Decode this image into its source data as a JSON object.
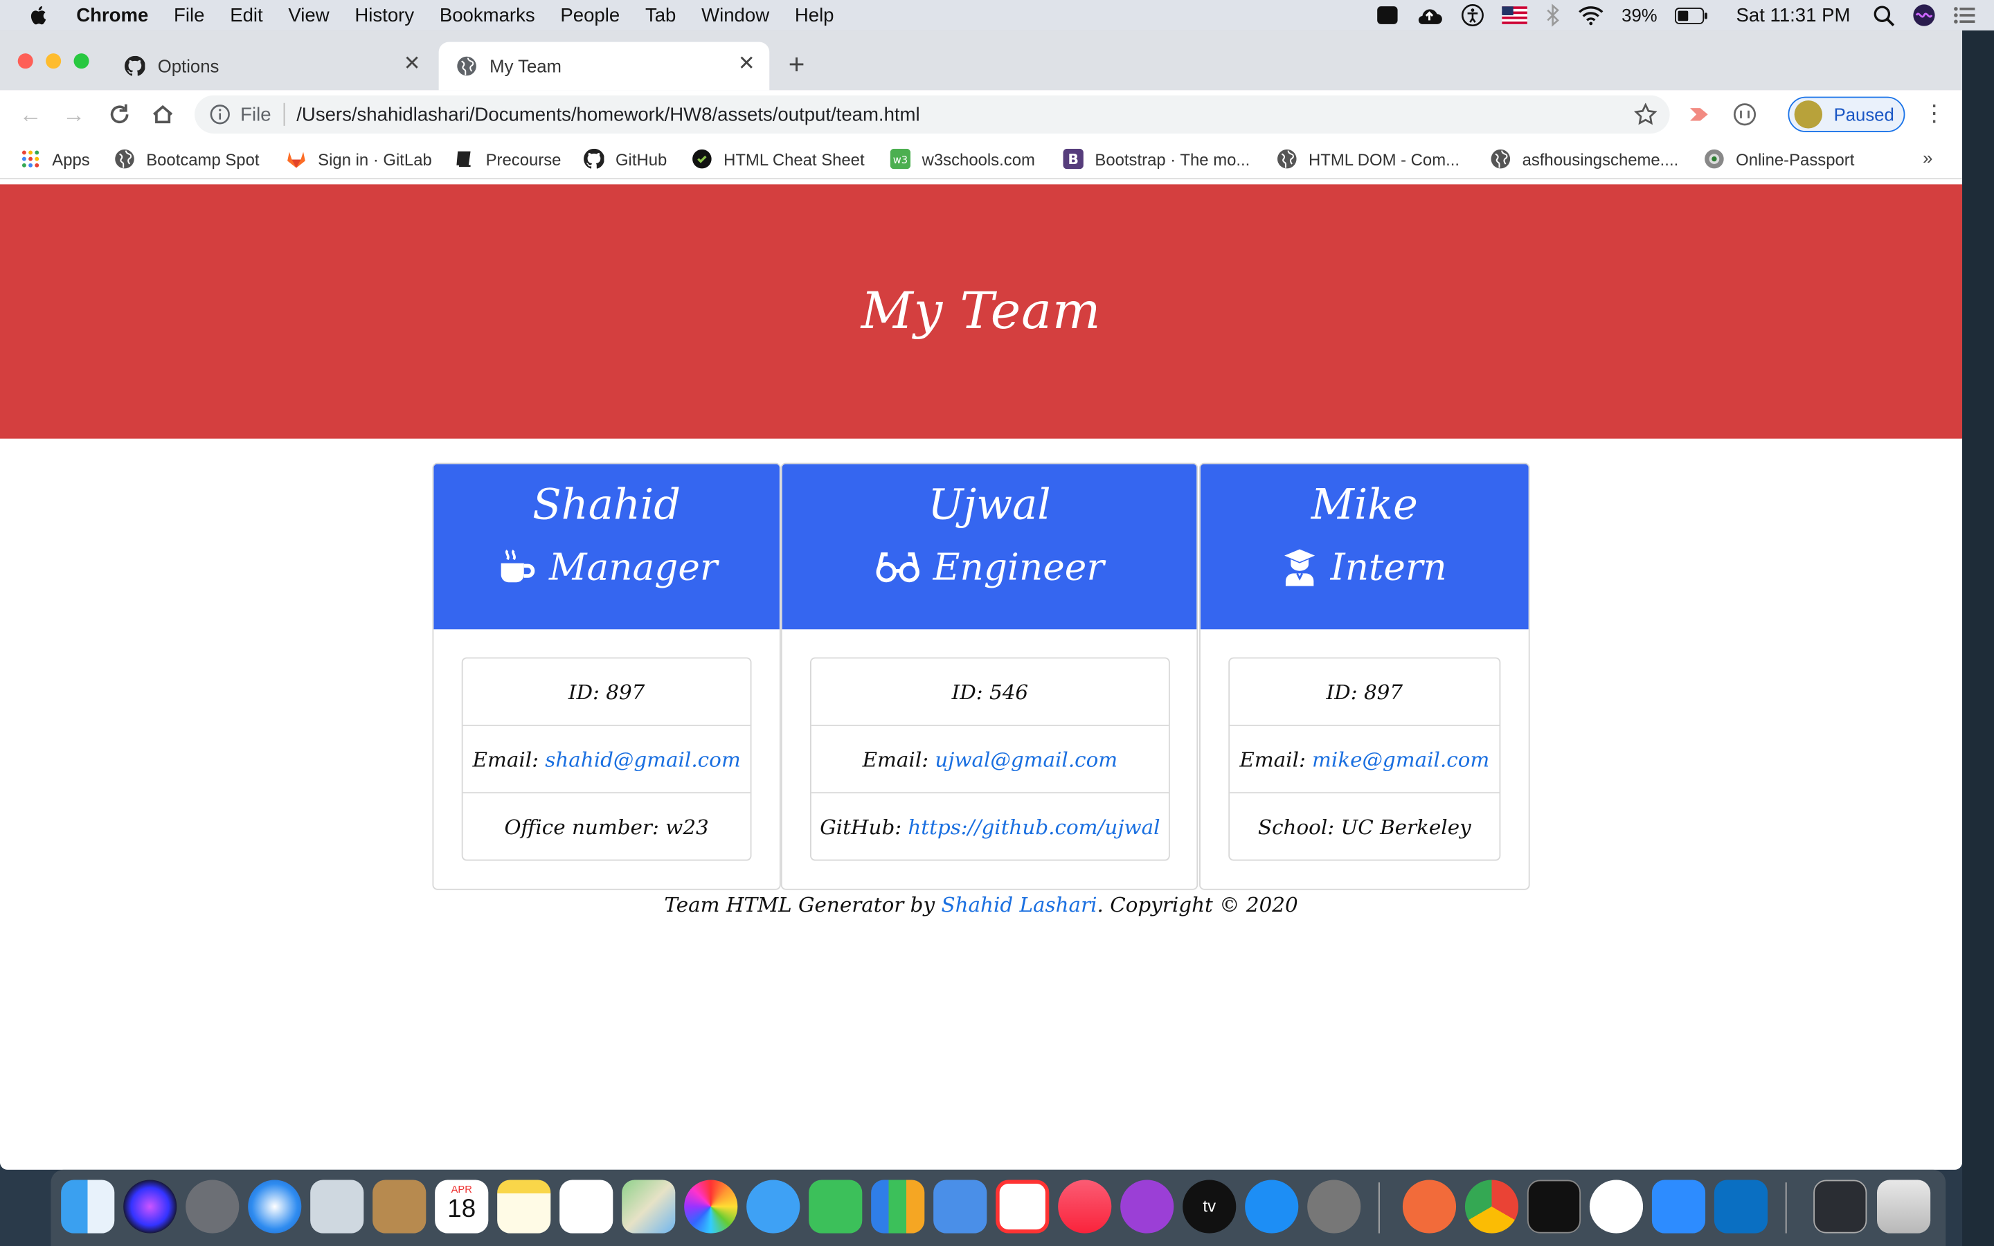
{
  "menubar": {
    "app": "Chrome",
    "items": [
      "File",
      "Edit",
      "View",
      "History",
      "Bookmarks",
      "People",
      "Tab",
      "Window",
      "Help"
    ],
    "battery": "39%",
    "clock": "Sat 11:31 PM"
  },
  "tabs": [
    {
      "title": "Options",
      "icon": "github-icon"
    },
    {
      "title": "My Team",
      "icon": "globe-icon"
    }
  ],
  "omnibox": {
    "scheme": "File",
    "url": "/Users/shahidlashari/Documents/homework/HW8/assets/output/team.html"
  },
  "profile": {
    "label": "Paused"
  },
  "bookmarks": [
    {
      "label": "Apps",
      "icon": "apps-grid-icon"
    },
    {
      "label": "Bootcamp Spot",
      "icon": "globe-icon"
    },
    {
      "label": "Sign in · GitLab",
      "icon": "gitlab-icon"
    },
    {
      "label": "Precourse",
      "icon": "book-icon"
    },
    {
      "label": "GitHub",
      "icon": "github-icon"
    },
    {
      "label": "HTML Cheat Sheet",
      "icon": "cheatsheet-icon"
    },
    {
      "label": "w3schools.com",
      "icon": "w3schools-icon"
    },
    {
      "label": "Bootstrap · The mo...",
      "icon": "bootstrap-icon"
    },
    {
      "label": "HTML DOM - Com...",
      "icon": "globe-icon"
    },
    {
      "label": "asfhousingscheme....",
      "icon": "globe-icon"
    },
    {
      "label": "Online-Passport",
      "icon": "passport-icon"
    }
  ],
  "page": {
    "title": "My Team",
    "cards": [
      {
        "name": "Shahid",
        "role": "Manager",
        "role_icon": "coffee-mug-icon",
        "id_text": "ID: 897",
        "email_label": "Email:",
        "email": "shahid@gmail.com",
        "extra_label": "Office number: w23",
        "extra_link": ""
      },
      {
        "name": "Ujwal",
        "role": "Engineer",
        "role_icon": "glasses-icon",
        "id_text": "ID: 546",
        "email_label": "Email:",
        "email": "ujwal@gmail.com",
        "extra_label": "GitHub:",
        "extra_link": "https://github.com/ujwal"
      },
      {
        "name": "Mike",
        "role": "Intern",
        "role_icon": "graduate-icon",
        "id_text": "ID: 897",
        "email_label": "Email:",
        "email": "mike@gmail.com",
        "extra_label": "School: UC Berkeley",
        "extra_link": ""
      }
    ],
    "footer": {
      "prefix": "Team HTML Generator by",
      "author": "Shahid Lashari",
      "suffix": ". Copyright © 2020"
    }
  },
  "colors": {
    "jumbotron": "#d43f3f",
    "card_header": "#3566f0",
    "link": "#1a6fe0"
  },
  "dock": {
    "calendar_month": "APR",
    "calendar_day": "18",
    "appletv_label": "tv"
  }
}
